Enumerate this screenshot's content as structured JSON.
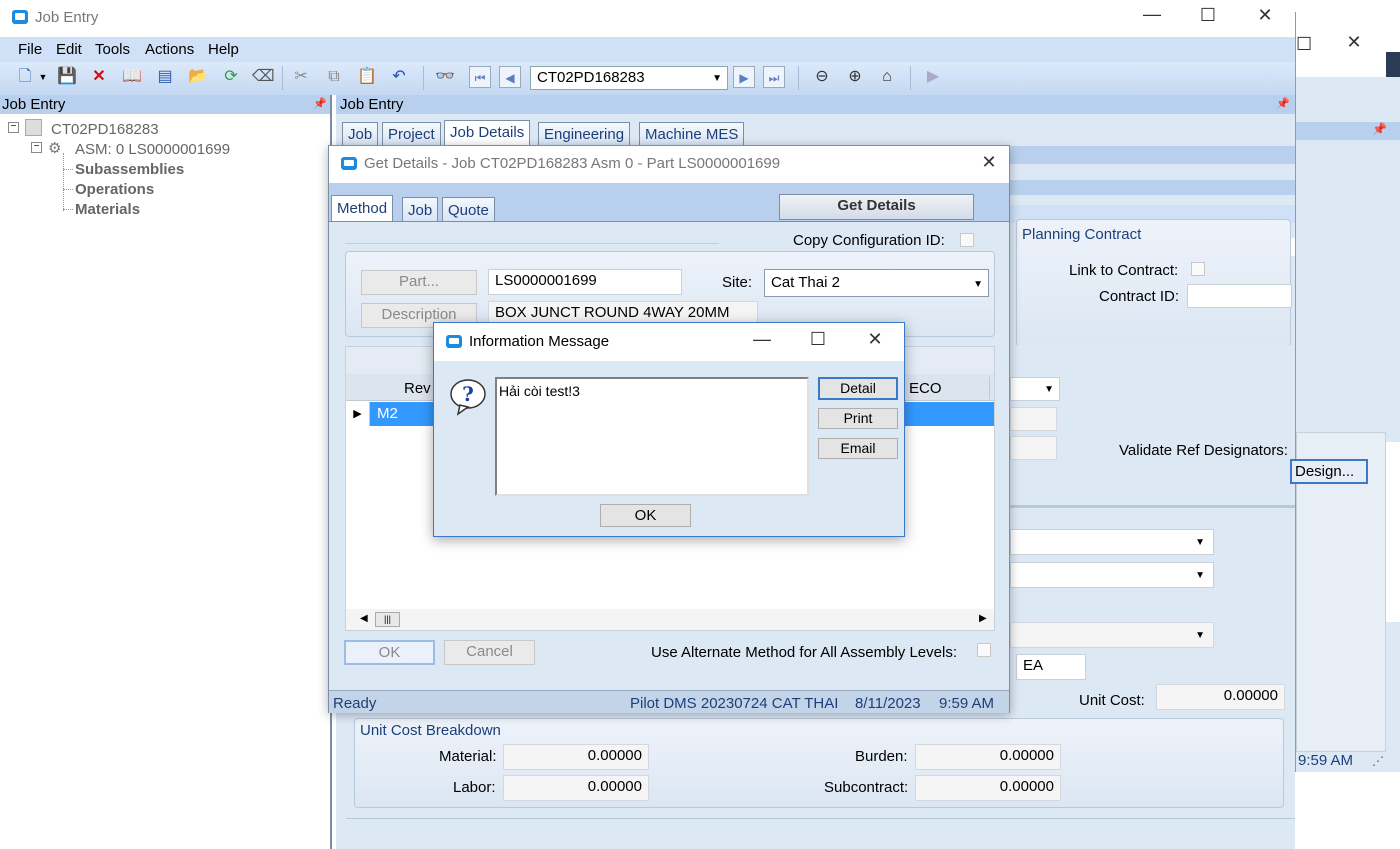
{
  "main_window": {
    "title": "Job Entry",
    "menu": [
      "File",
      "Edit",
      "Tools",
      "Actions",
      "Help"
    ],
    "toolbar": {
      "job_select_value": "CT02PD168283"
    },
    "left_panel": {
      "title": "Job Entry",
      "tree": {
        "root": "CT02PD168283",
        "asm": "ASM: 0 LS0000001699",
        "children": [
          "Subassemblies",
          "Operations",
          "Materials"
        ]
      }
    },
    "right_panel": {
      "title": "Job Entry",
      "tabs": [
        "Job",
        "Project",
        "Job Details",
        "Engineering",
        "Machine MES"
      ],
      "planning_contract": {
        "title": "Planning Contract",
        "link_label": "Link to Contract:",
        "contract_id_label": "Contract ID:",
        "contract_id_value": ""
      },
      "validate_ref_label": "Validate Ref Designators:",
      "design_button": "Design...",
      "uom_value": "EA",
      "unit_cost_label": "Unit Cost:",
      "unit_cost_value": "0.00000",
      "unit_cost_breakdown": {
        "title": "Unit Cost Breakdown",
        "material_label": "Material:",
        "material_value": "0.00000",
        "labor_label": "Labor:",
        "labor_value": "0.00000",
        "burden_label": "Burden:",
        "burden_value": "0.00000",
        "subcontract_label": "Subcontract:",
        "subcontract_value": "0.00000"
      }
    }
  },
  "back_window": {
    "time": "9:59 AM"
  },
  "get_details": {
    "title": "Get Details - Job CT02PD168283 Asm 0 - Part LS0000001699",
    "tabs": [
      "Method",
      "Job",
      "Quote"
    ],
    "get_details_button": "Get Details",
    "copy_config_label": "Copy Configuration ID:",
    "part_button": "Part...",
    "part_value": "LS0000001699",
    "site_label": "Site:",
    "site_value": "Cat Thai 2",
    "description_button": "Description",
    "description_value": "BOX JUNCT ROUND 4WAY 20MM",
    "grid": {
      "columns": [
        "Rev",
        "ECO"
      ],
      "rows": [
        {
          "rev": "M2"
        }
      ]
    },
    "ok_button": "OK",
    "cancel_button": "Cancel",
    "alt_method_label": "Use Alternate Method for All Assembly Levels:",
    "status": {
      "ready": "Ready",
      "company": "Pilot DMS 20230724 CAT THAI",
      "date": "8/11/2023",
      "time": "9:59 AM"
    }
  },
  "info_message": {
    "title": "Information Message",
    "message": "Hải còi test!3",
    "detail_button": "Detail",
    "print_button": "Print",
    "email_button": "Email",
    "ok_button": "OK"
  },
  "colors": {
    "menu_bg": "#cfe0f7",
    "panel_header": "#b8d0ee",
    "selected_row": "#3399ff",
    "dialog_title_bg": "#ffffff"
  }
}
